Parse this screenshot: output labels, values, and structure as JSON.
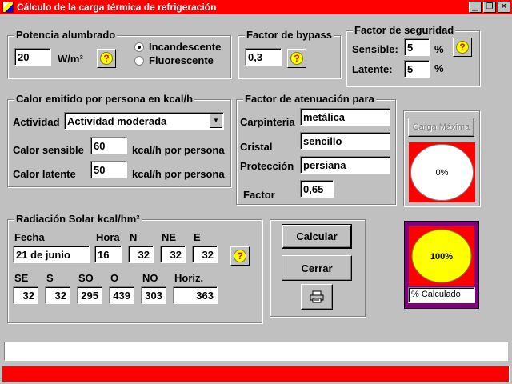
{
  "window": {
    "title": "Cálculo de la carga térmica de refrigeración",
    "icons": [
      "app-icon",
      "minimize-icon",
      "restore-icon",
      "close-icon"
    ]
  },
  "lighting": {
    "legend": "Potencia alumbrado",
    "value": "20",
    "unit": "W/m²",
    "options": [
      "Incandescente",
      "Fluorescente"
    ],
    "selected": "Incandescente"
  },
  "bypass": {
    "legend": "Factor de bypass",
    "value": "0,3"
  },
  "safety": {
    "legend": "Factor de seguridad",
    "sensible_label": "Sensible:",
    "sensible_value": "5",
    "latent_label": "Latente:",
    "latent_value": "5",
    "percent": "%"
  },
  "person": {
    "legend": "Calor emitido por persona en kcal/h",
    "activity_label": "Actividad",
    "activity_value": "Actividad moderada",
    "sensible_label": "Calor sensible",
    "sensible_value": "60",
    "latent_label": "Calor latente",
    "latent_value": "50",
    "unit": "kcal/h por persona"
  },
  "attenuation": {
    "legend": "Factor de atenuación para",
    "carpentry_label": "Carpinteria",
    "carpentry_value": "metálica",
    "glass_label": "Cristal",
    "glass_value": "sencillo",
    "protection_label": "Protección",
    "protection_value": "persiana",
    "factor_label": "Factor",
    "factor_value": "0,65"
  },
  "solar": {
    "legend": "Radiación Solar kcal/hm²",
    "date_label": "Fecha",
    "date_value": "21 de junio",
    "hour_label": "Hora",
    "hour_value": "16",
    "headers_top": [
      "N",
      "NE",
      "E"
    ],
    "values_top": [
      "32",
      "32",
      "32"
    ],
    "headers_bottom": [
      "SE",
      "S",
      "SO",
      "O",
      "NO",
      "Horiz."
    ],
    "values_bottom": [
      "32",
      "32",
      "295",
      "439",
      "303",
      "363"
    ]
  },
  "actions": {
    "calculate": "Calcular",
    "close": "Cerrar",
    "print_icon": "printer-icon"
  },
  "max_load": {
    "button": "Carga Máxima",
    "gauge_text": "0%",
    "gauge_percent": 0,
    "colors": {
      "background": "#ff0000",
      "circle": "#ffffff"
    }
  },
  "calculated": {
    "gauge_text": "100%",
    "gauge_percent": 100,
    "label": "% Calculado",
    "colors": {
      "frame": "#800080",
      "background": "#ff0000",
      "circle": "#ffff00"
    }
  },
  "status": {
    "text": "",
    "progress_fraction": 1.0,
    "progress_color": "#ff0000"
  },
  "colors": {
    "titlebar": "#ff0000",
    "face": "#c0c0c0",
    "help_icon": "#ffff00"
  }
}
